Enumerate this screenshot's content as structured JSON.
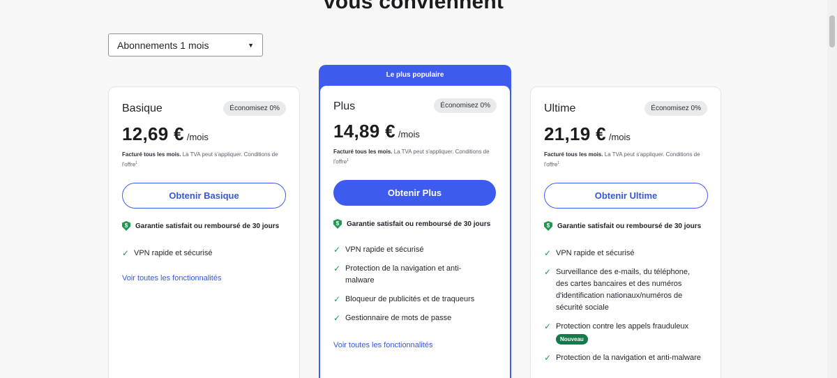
{
  "heading": "vous conviennent",
  "period_select": {
    "value": "Abonnements 1 mois"
  },
  "popular_banner": "Le plus populaire",
  "guarantee_text": "Garantie satisfait ou remboursé de 30 jours",
  "billing": {
    "bold": "Facturé tous les mois.",
    "rest": " La TVA peut s'appliquer. Conditions de l'offre",
    "footnote": "1"
  },
  "see_all": "Voir toutes les fonctionnalités",
  "plans": [
    {
      "name": "Basique",
      "badge": "Économisez 0%",
      "price": "12,69 €",
      "per": "/mois",
      "cta": "Obtenir Basique",
      "features": [
        "VPN rapide et sécurisé"
      ]
    },
    {
      "name": "Plus",
      "badge": "Économisez 0%",
      "price": "14,89 €",
      "per": "/mois",
      "cta": "Obtenir Plus",
      "features": [
        "VPN rapide et sécurisé",
        "Protection de la navigation et anti-malware",
        "Bloqueur de publicités et de traqueurs",
        "Gestionnaire de mots de passe"
      ]
    },
    {
      "name": "Ultime",
      "badge": "Économisez 0%",
      "price": "21,19 €",
      "per": "/mois",
      "cta": "Obtenir Ultime",
      "features": [
        "VPN rapide et sécurisé",
        "Surveillance des e-mails, du téléphone, des cartes bancaires et des numéros d'identification nationaux/numéros de sécurité sociale",
        "Protection contre les appels frauduleux",
        "Protection de la navigation et anti-malware"
      ],
      "new_badge": "Nouveau"
    }
  ],
  "colors": {
    "accent": "#3e5bf0",
    "check": "#1d9a4f",
    "new_badge": "#16794a"
  },
  "icons": {
    "dropdown": "caret-down-icon",
    "shield": "shield-dollar-icon",
    "check": "check-icon"
  }
}
